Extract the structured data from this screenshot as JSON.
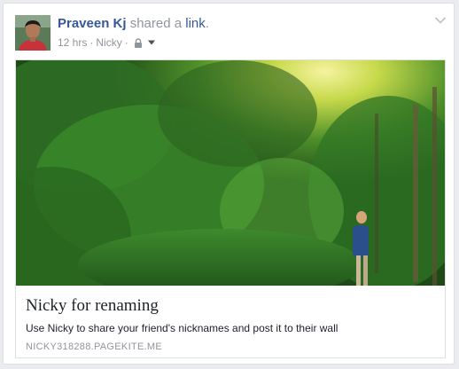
{
  "post": {
    "author": "Praveen Kj",
    "action_text": "shared a",
    "action_link": "link",
    "action_period": ".",
    "timestamp": "12 hrs",
    "separator": "·",
    "app_name": "Nicky",
    "privacy_icon": "lock-icon",
    "audience_icon": "caret-down-icon",
    "menu_icon": "chevron-down-icon"
  },
  "link_preview": {
    "title": "Nicky for renaming",
    "description": "Use Nicky to share your friend's nicknames and post it to their wall",
    "domain": "NICKY318288.PAGEKITE.ME"
  },
  "colors": {
    "author_blue": "#365899",
    "meta_gray": "#90949c",
    "text_dark": "#1d2129",
    "border": "#dddfe2",
    "background": "#e9ebee"
  }
}
